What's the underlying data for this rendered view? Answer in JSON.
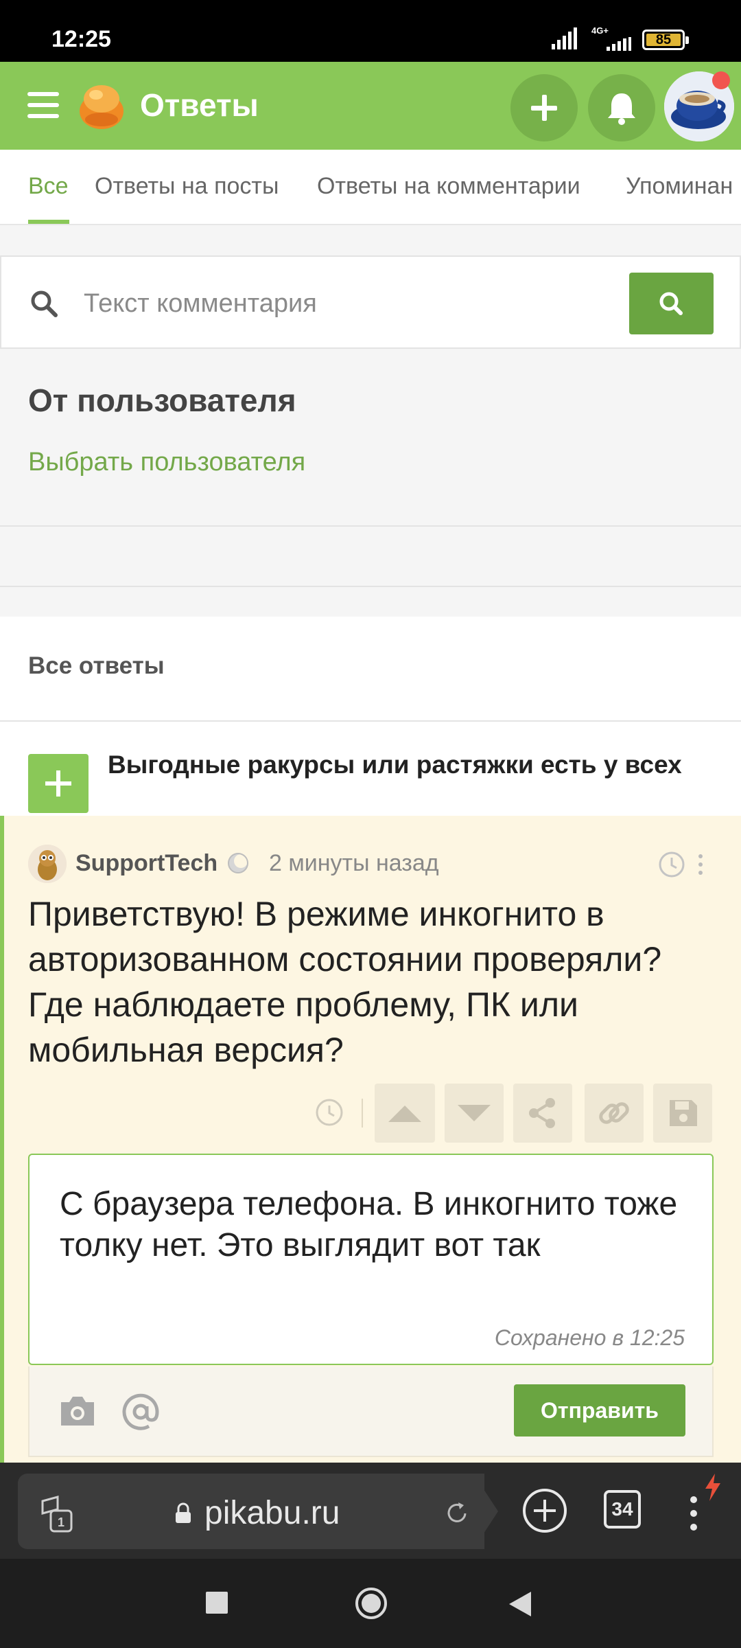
{
  "status_bar": {
    "time": "12:25",
    "network": "4G+",
    "battery": "85"
  },
  "header": {
    "title": "Ответы"
  },
  "tabs": [
    {
      "label": "Все",
      "active": true
    },
    {
      "label": "Ответы на посты"
    },
    {
      "label": "Ответы на комментарии"
    },
    {
      "label": "Упоминан"
    }
  ],
  "search": {
    "placeholder": "Текст комментария"
  },
  "filter": {
    "title": "От пользователя",
    "choose_user": "Выбрать пользователя"
  },
  "section": {
    "all_answers": "Все ответы"
  },
  "post": {
    "title": "Выгодные ракурсы или растяжки есть у всех"
  },
  "comment": {
    "author": "SupportTech",
    "time_ago": "2 минуты назад",
    "text": "Приветствую! В режиме инкогнито в авторизованном состоянии проверяли? Где наблюдаете проблему, ПК или мобильная версия?"
  },
  "reply": {
    "text": "С браузера телефона. В инкогнито тоже толку нет. Это выглядит вот так",
    "saved": "Сохранено в 12:25",
    "send_label": "Отправить"
  },
  "browser": {
    "url": "pikabu.ru",
    "tab_count": "34",
    "small_badge": "1"
  },
  "colors": {
    "brand_green": "#8ac858",
    "button_green": "#6aa541",
    "comment_bg": "#fdf6e2",
    "notification": "#f1554f"
  }
}
